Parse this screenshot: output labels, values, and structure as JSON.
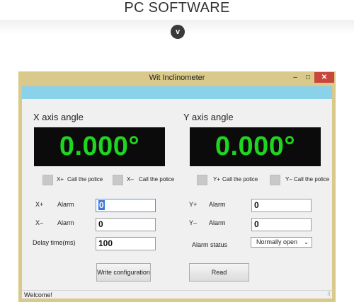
{
  "page": {
    "heading": "PC SOFTWARE",
    "toggle_glyph": "v"
  },
  "window": {
    "title": "Wit Inclinometer",
    "minimize_glyph": "–",
    "maximize_glyph": "□",
    "close_glyph": "✕"
  },
  "x_axis": {
    "title": "X axis angle",
    "display": "0.000°",
    "plus_label": "X+",
    "minus_label": "X–",
    "call_police": "Call the police",
    "alarm_label": "Alarm",
    "plus_alarm_value": "0",
    "minus_alarm_value": "0"
  },
  "y_axis": {
    "title": "Y axis angle",
    "display": "0.000°",
    "plus_label": "Y+",
    "minus_label": "Y–",
    "call_police": "Call the police",
    "alarm_label": "Alarm",
    "plus_alarm_value": "0",
    "minus_alarm_value": "0"
  },
  "settings": {
    "delay_label": "Delay time(ms)",
    "delay_value": "100",
    "alarm_status_label": "Alarm status",
    "alarm_status_value": "Normally open",
    "caret_glyph": "⌄"
  },
  "buttons": {
    "write": "Write configuration",
    "read": "Read"
  },
  "statusbar": {
    "text": "Welcome!",
    "grip": "⠿"
  },
  "colors": {
    "display_bg": "#0b0b0b",
    "display_fg": "#1fd51f",
    "title_border": "#d9c98a",
    "accent_bar": "#8ad1ea",
    "close_button": "#c9463d"
  }
}
